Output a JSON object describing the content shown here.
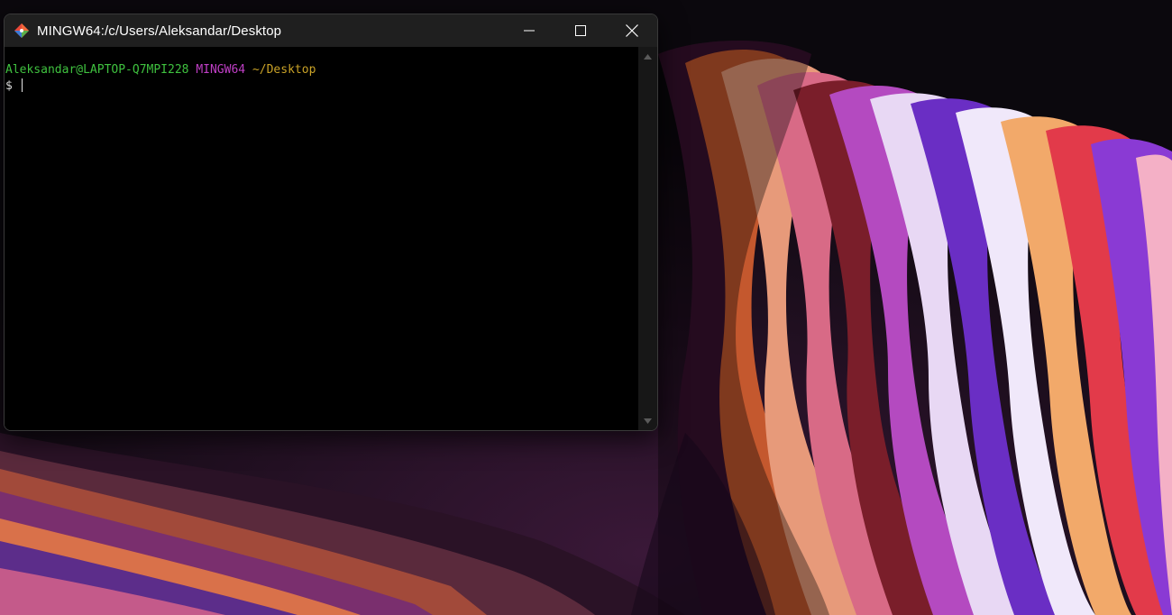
{
  "window": {
    "title": "MINGW64:/c/Users/Aleksandar/Desktop",
    "controls": {
      "minimize_icon": "minimize-icon",
      "maximize_icon": "maximize-icon",
      "close_icon": "close-icon"
    }
  },
  "terminal": {
    "user_host": "Aleksandar@LAPTOP-Q7MPI228",
    "system": "MINGW64",
    "cwd": "~/Desktop",
    "prompt": "$ "
  },
  "colors": {
    "user_host": "#3fc13f",
    "system": "#c03fc6",
    "cwd": "#c9a227",
    "terminal_bg": "#000000",
    "titlebar_bg": "#1f1f1f"
  }
}
